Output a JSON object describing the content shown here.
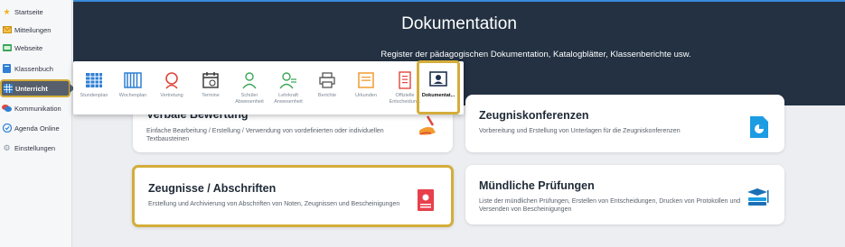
{
  "sidebar": {
    "items": [
      {
        "label": "Startseite",
        "icon": "star-icon"
      },
      {
        "label": "Mitteilungen",
        "icon": "envelope-icon"
      },
      {
        "label": "Webseite",
        "icon": "globe-icon"
      },
      {
        "label": "Klassenbuch",
        "icon": "book-icon"
      },
      {
        "label": "Unterricht",
        "icon": "grid-icon"
      },
      {
        "label": "Kommunikation",
        "icon": "chat-icon"
      },
      {
        "label": "Agenda Online",
        "icon": "agenda-icon"
      },
      {
        "label": "Einstellungen",
        "icon": "gear-icon"
      }
    ]
  },
  "header": {
    "title": "Dokumentation",
    "subtitle": "Register der pädagogischen Dokumentation, Katalogblätter, Klassenberichte usw."
  },
  "toolbar": {
    "items": [
      {
        "label": "Stundenplan",
        "icon": "timetable-icon"
      },
      {
        "label": "Wochenplan",
        "icon": "week-plan-icon"
      },
      {
        "label": "Vertretung",
        "icon": "substitution-icon"
      },
      {
        "label": "Termine",
        "icon": "calendar-icon"
      },
      {
        "label": "Schüler Abwesenheit",
        "icon": "student-absence-icon"
      },
      {
        "label": "Lehrkraft Anwesenheit",
        "icon": "teacher-attendance-icon"
      },
      {
        "label": "Berichte",
        "icon": "printer-icon"
      },
      {
        "label": "Urkunden",
        "icon": "certificate-icon"
      },
      {
        "label": "Offizielle Entscheidun...",
        "icon": "official-decision-icon"
      },
      {
        "label": "Dokumentat...",
        "icon": "documentation-icon"
      }
    ]
  },
  "cards": [
    {
      "title": "Verbale Bewertung",
      "desc": "Einfache Bearbeitung / Erstellung / Verwendung von vordefinierten oder individuellen Textbausteinen",
      "icon": "hand-writing-icon"
    },
    {
      "title": "Zeugniskonferenzen",
      "desc": "Vorbereitung und Erstellung von Unterlagen für die Zeugniskonferenzen",
      "icon": "chart-document-icon"
    },
    {
      "title": "Zeugnisse / Abschriften",
      "desc": "Erstellung und Archivierung von Abschriften von Noten, Zeugnissen und Bescheinigungen",
      "icon": "certificate-document-icon"
    },
    {
      "title": "Mündliche Prüfungen",
      "desc": "Liste der mündlichen Prüfungen, Erstellen von Entscheidungen, Drucken von Protokollen und Versenden von Bescheinigungen",
      "icon": "books-icon"
    }
  ],
  "colors": {
    "header_bg": "#233142",
    "highlight": "#d4ad3a",
    "active_nav": "#565f6b",
    "accent_blue": "#1b9ce3"
  }
}
